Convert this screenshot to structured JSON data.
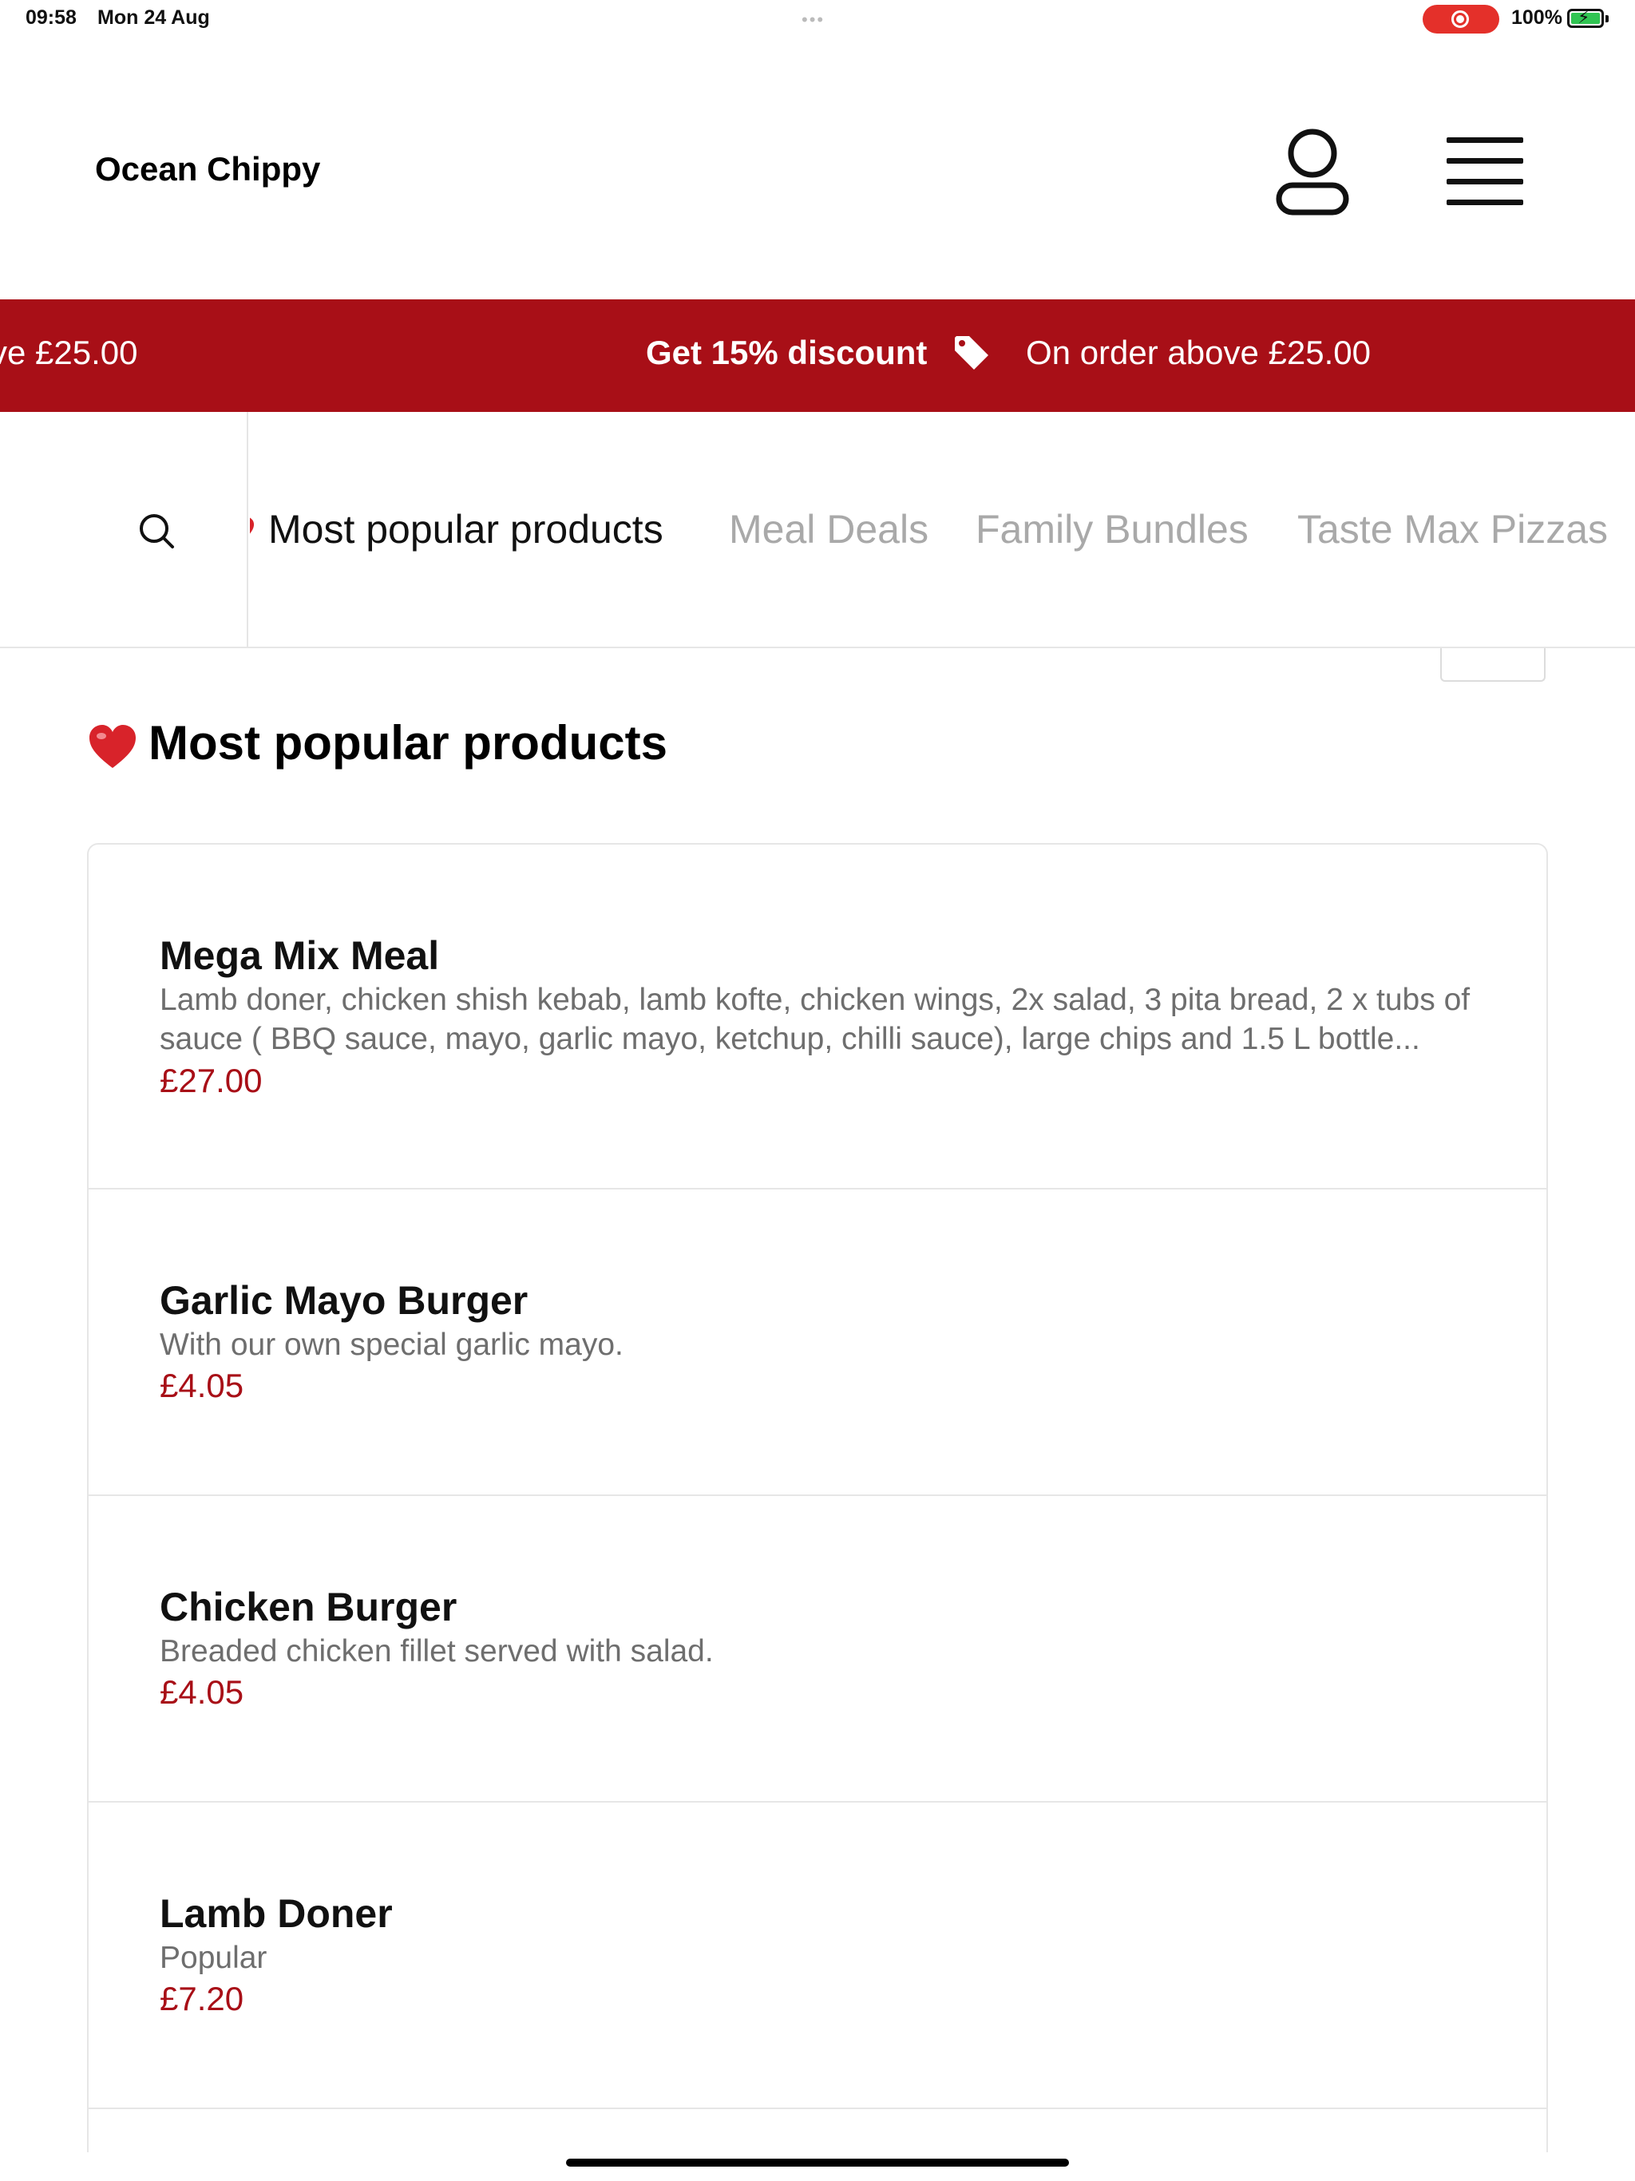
{
  "status_bar": {
    "time": "09:58",
    "date": "Mon 24 Aug",
    "battery": "100%",
    "multitask_dots": "•••"
  },
  "header": {
    "brand": "Ocean Chippy",
    "account_icon": "user-icon",
    "menu_icon": "hamburger-menu-icon"
  },
  "promo": {
    "left_fragment": "ve £25.00",
    "title": "Get 15% discount",
    "icon": "tag-icon",
    "subtitle": "On order above £25.00",
    "color": "#a80f17"
  },
  "category_nav": {
    "search_icon": "search-icon",
    "tabs": [
      {
        "label": "Most popular products",
        "active": true
      },
      {
        "label": "Meal Deals",
        "active": false
      },
      {
        "label": "Family Bundles",
        "active": false
      },
      {
        "label": "Taste Max Pizzas",
        "active": false
      }
    ]
  },
  "section": {
    "title": "Most popular products",
    "icon": "heart-icon"
  },
  "products": [
    {
      "name": "Mega Mix Meal",
      "description": "Lamb doner, chicken shish kebab, lamb kofte, chicken wings, 2x salad, 3 pita bread, 2 x tubs of sauce ( BBQ sauce, mayo, garlic mayo, ketchup, chilli sauce), large chips and 1.5 L bottle...",
      "price": "£27.00"
    },
    {
      "name": "Garlic Mayo Burger",
      "description": "With our own special garlic mayo.",
      "price": "£4.05"
    },
    {
      "name": "Chicken Burger",
      "description": "Breaded chicken fillet served with salad.",
      "price": "£4.05"
    },
    {
      "name": "Lamb Doner",
      "description": "Popular",
      "price": "£7.20"
    }
  ],
  "colors": {
    "accent": "#a80f17",
    "text": "#111111",
    "muted": "#6e6e6e",
    "inactive_tab": "#a9a9a9",
    "divider": "#e6e6e6"
  }
}
